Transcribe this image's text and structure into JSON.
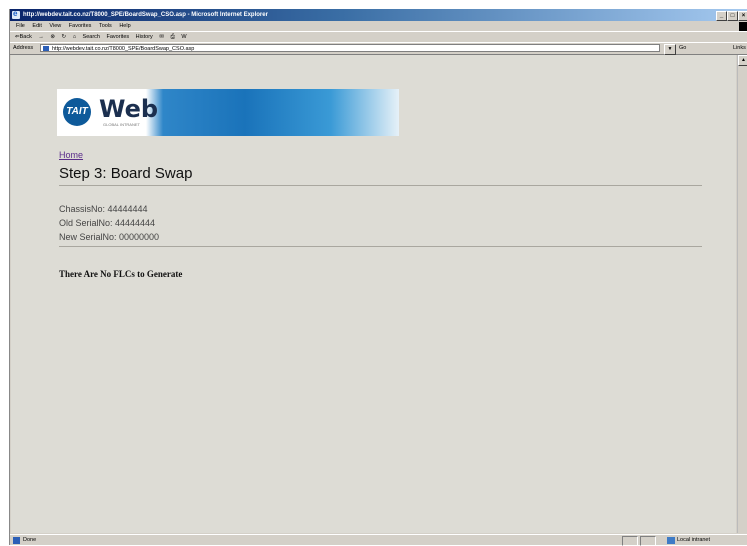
{
  "window": {
    "title": "http://webdev.tait.co.nz/T8000_SPE/BoardSwap_CSO.asp - Microsoft Internet Explorer",
    "minimize_label": "_",
    "restore_label": "□",
    "close_label": "×"
  },
  "menu": [
    "File",
    "Edit",
    "View",
    "Favorites",
    "Tools",
    "Help"
  ],
  "toolbar": {
    "back_label": "⇐Back",
    "forward_label": "→",
    "stop_label": "⊗",
    "refresh_label": "↻",
    "home_label": "⌂",
    "search_label": "Search",
    "favorites_label": "Favorites",
    "history_label": "History",
    "mail_label": "✉",
    "print_label": "⎙",
    "edit_label": "W"
  },
  "address": {
    "label": "Address",
    "url": "http://webdev.tait.co.nz/T8000_SPE/BoardSwap_CSO.asp",
    "go_label": "Go",
    "links_label": "Links"
  },
  "banner": {
    "logo_text": "TAIT",
    "title": "Web",
    "tagline": "GLOBAL INTRANET"
  },
  "page": {
    "home_link": "Home",
    "heading": "Step 3: Board Swap",
    "chassis": "ChassisNo: 44444444",
    "old_serial": "Old SerialNo: 44444444",
    "new_serial": "New SerialNo: 00000000",
    "message": "There Are No FLCs to Generate"
  },
  "status": {
    "text": "Done",
    "zone": "Local intranet"
  }
}
